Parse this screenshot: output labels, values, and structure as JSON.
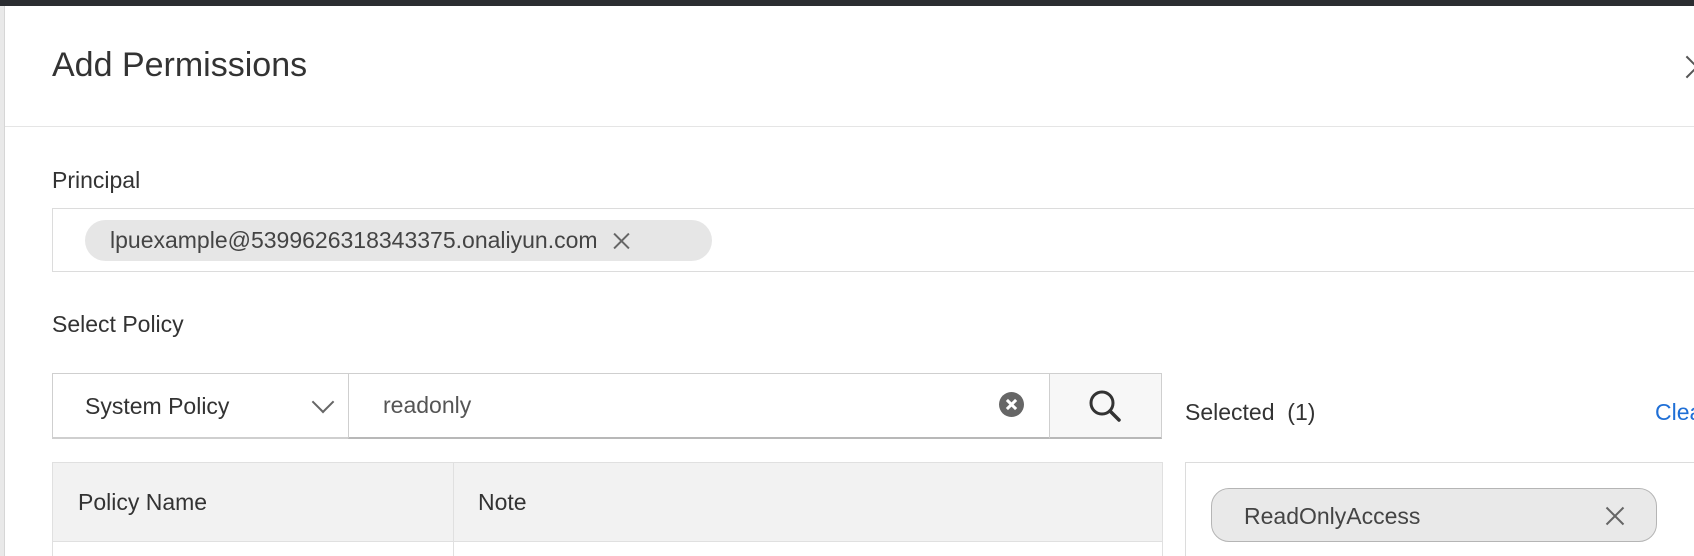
{
  "dialog": {
    "title": "Add Permissions"
  },
  "principal": {
    "label": "Principal",
    "tags": [
      "lpuexample@5399626318343375.onaliyun.com"
    ]
  },
  "policy": {
    "label": "Select Policy",
    "type_select": {
      "selected": "System Policy"
    },
    "search": {
      "value": "readonly"
    }
  },
  "table": {
    "columns": [
      "Policy Name",
      "Note"
    ]
  },
  "selected": {
    "label": "Selected  (1)",
    "clear_link": "Clea",
    "items": [
      "ReadOnlyAccess"
    ]
  },
  "icons": {
    "close": "close-icon",
    "remove_tag": "close-icon",
    "dropdown": "chevron-down-icon",
    "clear_input": "clear-circle-icon",
    "search": "search-icon"
  },
  "colors": {
    "link": "#1f6fd6",
    "header_bg": "#f2f2f2",
    "tag_bg": "#e6e6e6"
  }
}
